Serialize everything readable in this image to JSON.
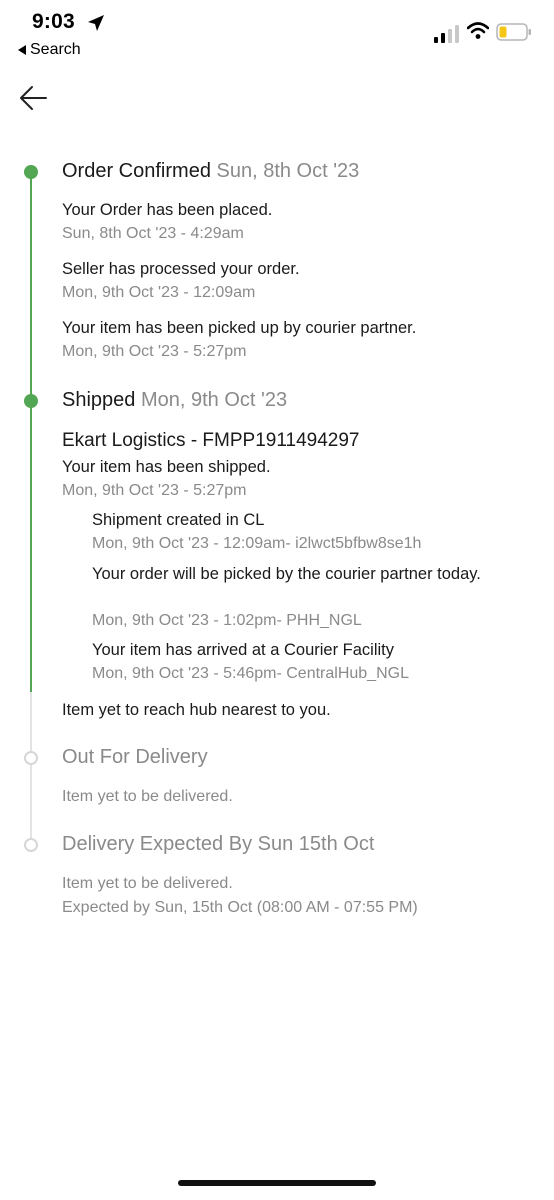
{
  "status_bar": {
    "time": "9:03",
    "back_app_label": "Search",
    "icons": [
      "location-arrow-icon",
      "cellular-signal-icon",
      "wifi-icon",
      "battery-icon"
    ]
  },
  "nav": {
    "back_icon": "arrow-left-icon"
  },
  "colors": {
    "completed": "#53a653",
    "pending": "#d6d6d6",
    "muted_text": "#8a8a8a",
    "battery_low": "#f5c518"
  },
  "timeline": {
    "order_confirmed": {
      "title": "Order Confirmed",
      "date": "Sun, 8th Oct '23",
      "events": [
        {
          "text": "Your Order has been placed.",
          "time": "Sun, 8th Oct '23 - 4:29am"
        },
        {
          "text": "Seller has processed your order.",
          "time": "Mon, 9th Oct '23 - 12:09am"
        },
        {
          "text": "Your item has been picked up by courier partner.",
          "time": "Mon, 9th Oct '23 - 5:27pm"
        }
      ]
    },
    "shipped": {
      "title": "Shipped",
      "date": "Mon, 9th Oct '23",
      "courier": "Ekart Logistics - FMPP1911494297",
      "status": "Your item has been shipped.",
      "status_time": "Mon, 9th Oct '23 - 5:27pm",
      "sub_events": [
        {
          "text": "Shipment created in CL",
          "time": "Mon, 9th Oct '23 - 12:09am- i2lwct5bfbw8se1h"
        },
        {
          "text": "Your order will be picked by the courier partner today.",
          "time": "Mon, 9th Oct '23 - 1:02pm- PHH_NGL"
        },
        {
          "text": "Your item has arrived at a Courier Facility",
          "time": "Mon, 9th Oct '23 - 5:46pm- CentralHub_NGL"
        }
      ],
      "hub_note": "Item yet to reach hub nearest to you."
    },
    "out_for_delivery": {
      "title": "Out For Delivery",
      "note": "Item yet to be delivered."
    },
    "delivery_expected": {
      "title": "Delivery Expected By Sun 15th Oct",
      "note": "Item yet to be delivered.",
      "expected": "Expected by Sun, 15th Oct (08:00 AM - 07:55 PM)"
    }
  }
}
